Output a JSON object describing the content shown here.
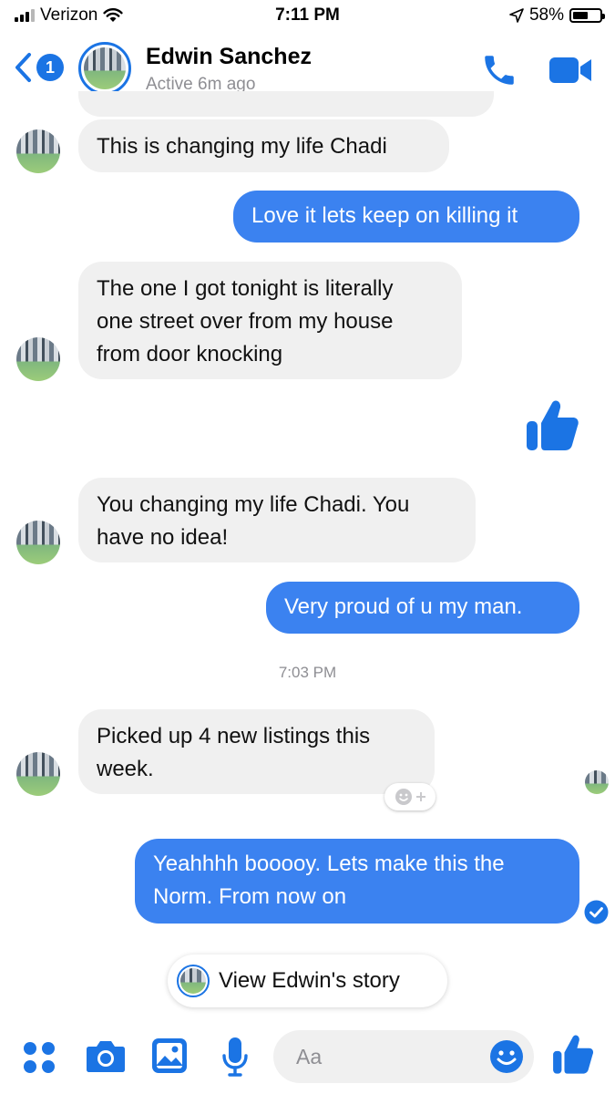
{
  "status_bar": {
    "carrier": "Verizon",
    "time": "7:11 PM",
    "battery": "58%",
    "battery_level": 0.58
  },
  "header": {
    "back_badge": "1",
    "contact_name": "Edwin Sanchez",
    "active_status": "Active 6m ago"
  },
  "messages": [
    {
      "from": "them",
      "text": "This is changing my life Chadi"
    },
    {
      "from": "me",
      "text": "Love it lets keep on killing it"
    },
    {
      "from": "them",
      "lines": [
        "The one I got tonight is literally",
        "one street over from my house",
        "from door knocking"
      ]
    },
    {
      "from": "me",
      "type": "like"
    },
    {
      "from": "them",
      "lines": [
        "You changing my life Chadi. You",
        "have no idea!"
      ]
    },
    {
      "from": "me",
      "text": "Very proud of u my man."
    },
    {
      "from": "them",
      "lines": [
        "Picked up 4 new listings this",
        "week."
      ]
    },
    {
      "from": "me",
      "lines": [
        "Yeahhhh booooy. Lets make this the",
        "Norm. From now on"
      ]
    }
  ],
  "timestamp": "7:03 PM",
  "story_button": "View Edwin's story",
  "composer": {
    "placeholder": "Aa"
  },
  "colors": {
    "accent": "#1b74e4",
    "outgoing_bubble": "#3b82f0",
    "incoming_bubble": "#f0f0f0"
  }
}
